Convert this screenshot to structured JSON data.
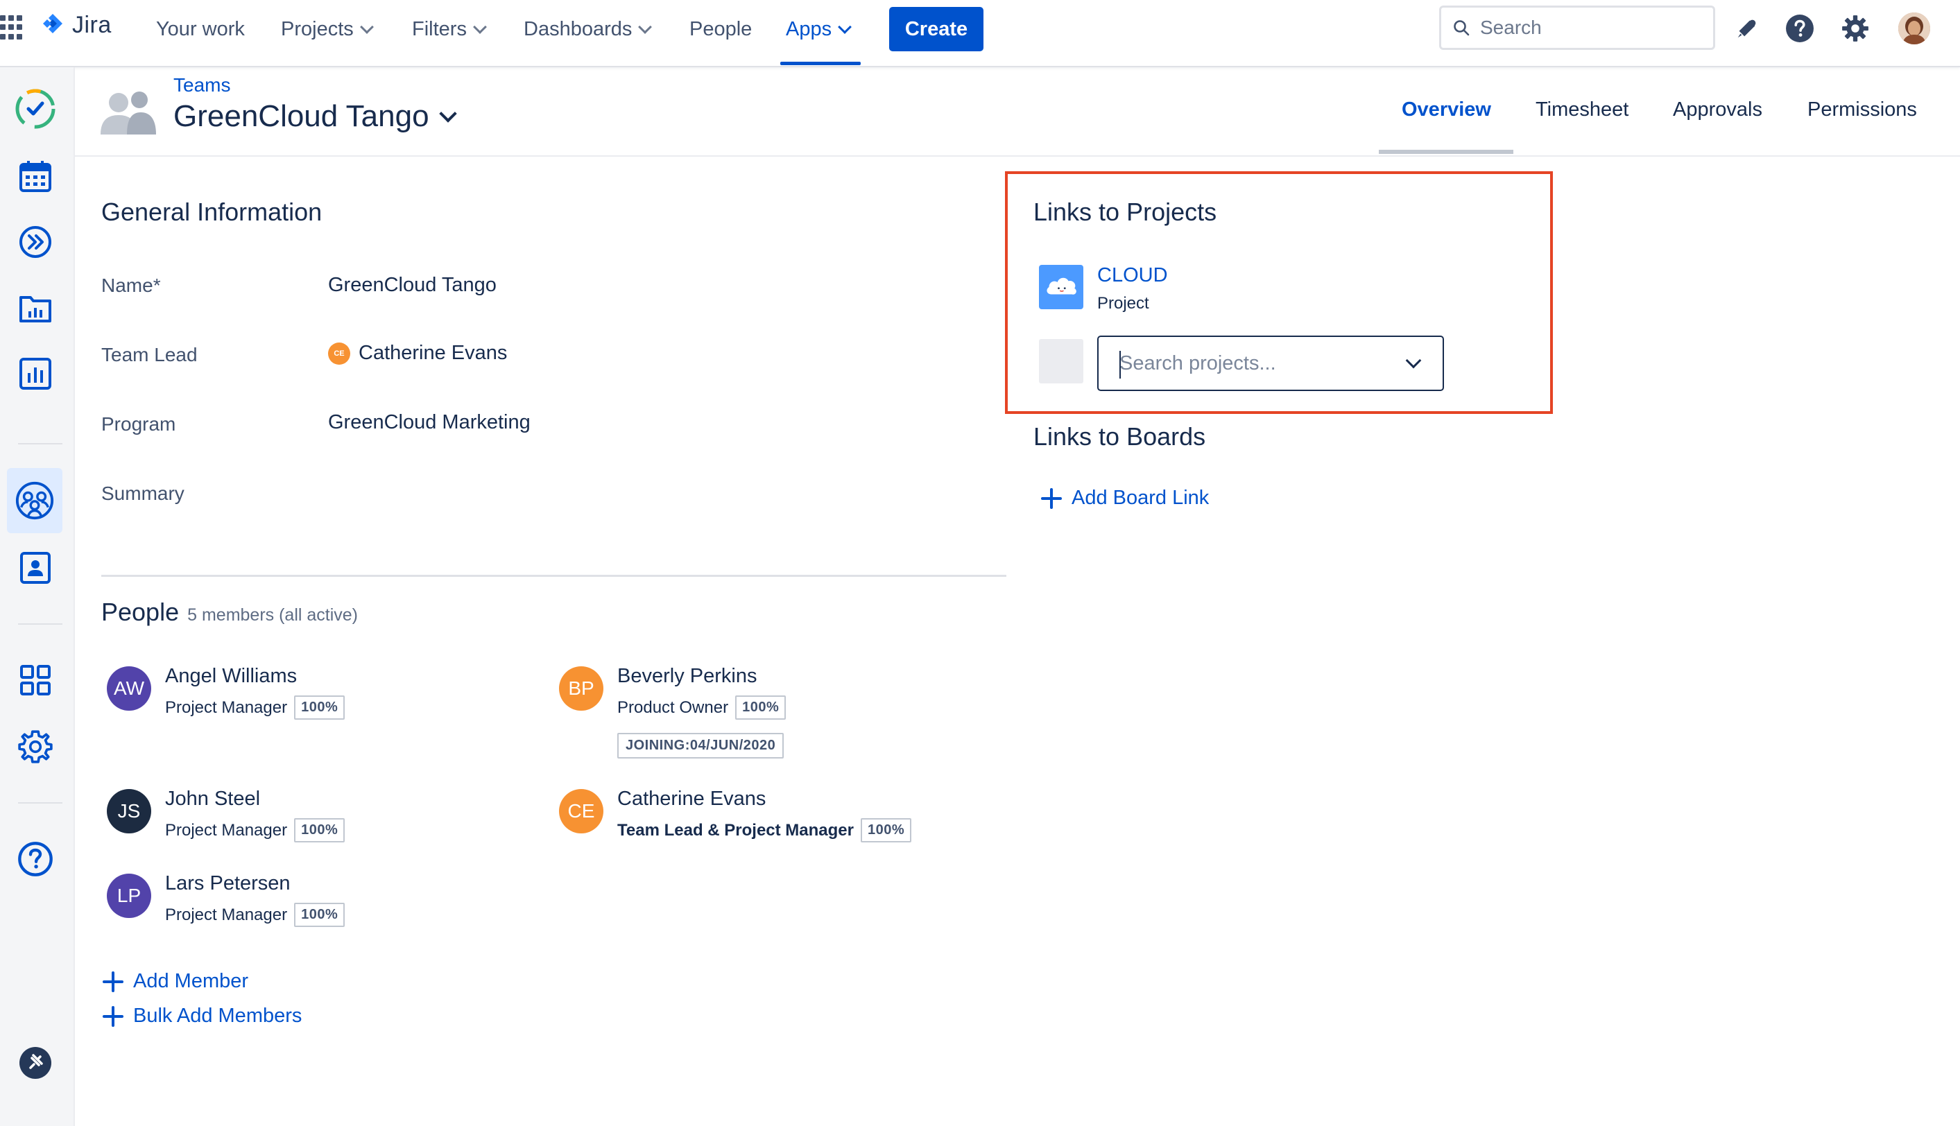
{
  "nav": {
    "logo": "Jira",
    "items": [
      {
        "label": "Your work"
      },
      {
        "label": "Projects"
      },
      {
        "label": "Filters"
      },
      {
        "label": "Dashboards"
      },
      {
        "label": "People"
      },
      {
        "label": "Apps"
      }
    ],
    "active_item": "Apps",
    "create_label": "Create",
    "search_placeholder": "Search"
  },
  "sidebar": {
    "icons": [
      "checkmark-app-icon",
      "calendar-icon",
      "chevron-forward-icon",
      "folder-chart-icon",
      "bar-chart-icon",
      "teams-icon",
      "user-card-icon",
      "grid-apps-icon",
      "gear-icon",
      "help-icon",
      "pin-icon"
    ],
    "selected": "teams-icon"
  },
  "header": {
    "breadcrumb": "Teams",
    "title": "GreenCloud Tango",
    "tabs": [
      {
        "label": "Overview"
      },
      {
        "label": "Timesheet"
      },
      {
        "label": "Approvals"
      },
      {
        "label": "Permissions"
      }
    ],
    "active_tab": "Overview"
  },
  "general": {
    "title": "General Information",
    "fields": [
      {
        "label": "Name*",
        "value": "GreenCloud Tango"
      },
      {
        "label": "Team Lead",
        "value": "Catherine Evans",
        "avatar_initials": "CE"
      },
      {
        "label": "Program",
        "value": "GreenCloud Marketing"
      },
      {
        "label": "Summary",
        "value": ""
      }
    ]
  },
  "people": {
    "title": "People",
    "subtitle": "5 members (all active)",
    "members": [
      {
        "initials": "AW",
        "name": "Angel Williams",
        "role": "Project Manager",
        "allocation": "100%",
        "color": "#5243aa"
      },
      {
        "initials": "BP",
        "name": "Beverly Perkins",
        "role": "Product Owner",
        "allocation": "100%",
        "badge": "JOINING:04/JUN/2020",
        "color": "#f79232"
      },
      {
        "initials": "JS",
        "name": "John Steel",
        "role": "Project Manager",
        "allocation": "100%",
        "color": "#1c2b41"
      },
      {
        "initials": "CE",
        "name": "Catherine Evans",
        "role": "Team Lead & Project Manager",
        "allocation": "100%",
        "color": "#f79232"
      },
      {
        "initials": "LP",
        "name": "Lars Petersen",
        "role": "Project Manager",
        "allocation": "100%",
        "color": "#5243aa"
      }
    ],
    "add_member": "Add Member",
    "bulk_add": "Bulk Add Members"
  },
  "projects": {
    "title": "Links to Projects",
    "linked": {
      "name": "CLOUD",
      "type": "Project"
    },
    "search_placeholder": "Search projects..."
  },
  "boards": {
    "title": "Links to Boards",
    "add_link": "Add Board Link"
  },
  "colors": {
    "accent": "#0052cc",
    "highlight": "#e54425",
    "text": "#172b4d"
  }
}
